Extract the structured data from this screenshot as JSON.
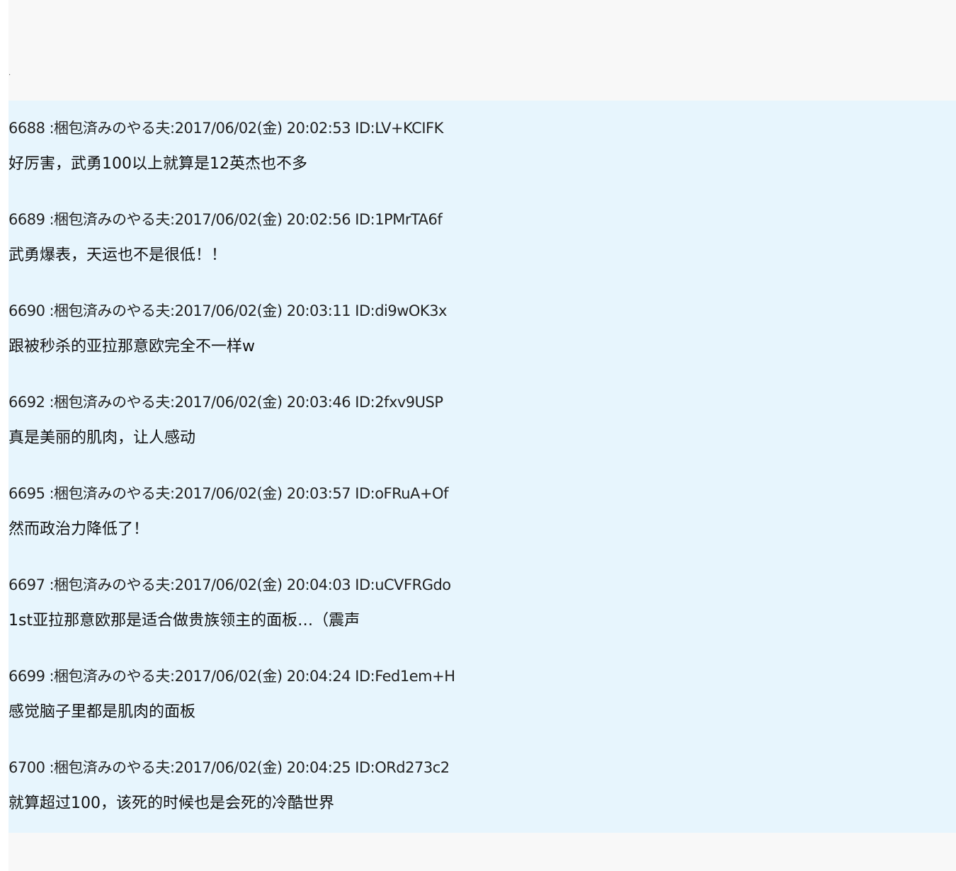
{
  "top_marker": ".",
  "posts": [
    {
      "number": "6688",
      "separator": ":",
      "name": "梱包済みのやる夫",
      "colon": ":",
      "date": "2017/06/02(金)",
      "time": "20:02:53",
      "id": "ID:LV+KCIFK",
      "body": "好厉害，武勇100以上就算是12英杰也不多"
    },
    {
      "number": "6689",
      "separator": ":",
      "name": "梱包済みのやる夫",
      "colon": ":",
      "date": "2017/06/02(金)",
      "time": "20:02:56",
      "id": "ID:1PMrTA6f",
      "body": "武勇爆表，天运也不是很低！！"
    },
    {
      "number": "6690",
      "separator": ":",
      "name": "梱包済みのやる夫",
      "colon": ":",
      "date": "2017/06/02(金)",
      "time": "20:03:11",
      "id": "ID:di9wOK3x",
      "body": "跟被秒杀的亚拉那意欧完全不一样w"
    },
    {
      "number": "6692",
      "separator": ":",
      "name": "梱包済みのやる夫",
      "colon": ":",
      "date": "2017/06/02(金)",
      "time": "20:03:46",
      "id": "ID:2fxv9USP",
      "body": "真是美丽的肌肉，让人感动"
    },
    {
      "number": "6695",
      "separator": ":",
      "name": "梱包済みのやる夫",
      "colon": ":",
      "date": "2017/06/02(金)",
      "time": "20:03:57",
      "id": "ID:oFRuA+Of",
      "body": "然而政治力降低了！"
    },
    {
      "number": "6697",
      "separator": ":",
      "name": "梱包済みのやる夫",
      "colon": ":",
      "date": "2017/06/02(金)",
      "time": "20:04:03",
      "id": "ID:uCVFRGdo",
      "body": "1st亚拉那意欧那是适合做贵族领主的面板…（震声"
    },
    {
      "number": "6699",
      "separator": ":",
      "name": "梱包済みのやる夫",
      "colon": ":",
      "date": "2017/06/02(金)",
      "time": "20:04:24",
      "id": "ID:Fed1em+H",
      "body": "感觉脑子里都是肌肉的面板"
    },
    {
      "number": "6700",
      "separator": ":",
      "name": "梱包済みのやる夫",
      "colon": ":",
      "date": "2017/06/02(金)",
      "time": "20:04:25",
      "id": "ID:ORd273c2",
      "body": "就算超过100，该死的时候也是会死的冷酷世界"
    }
  ]
}
